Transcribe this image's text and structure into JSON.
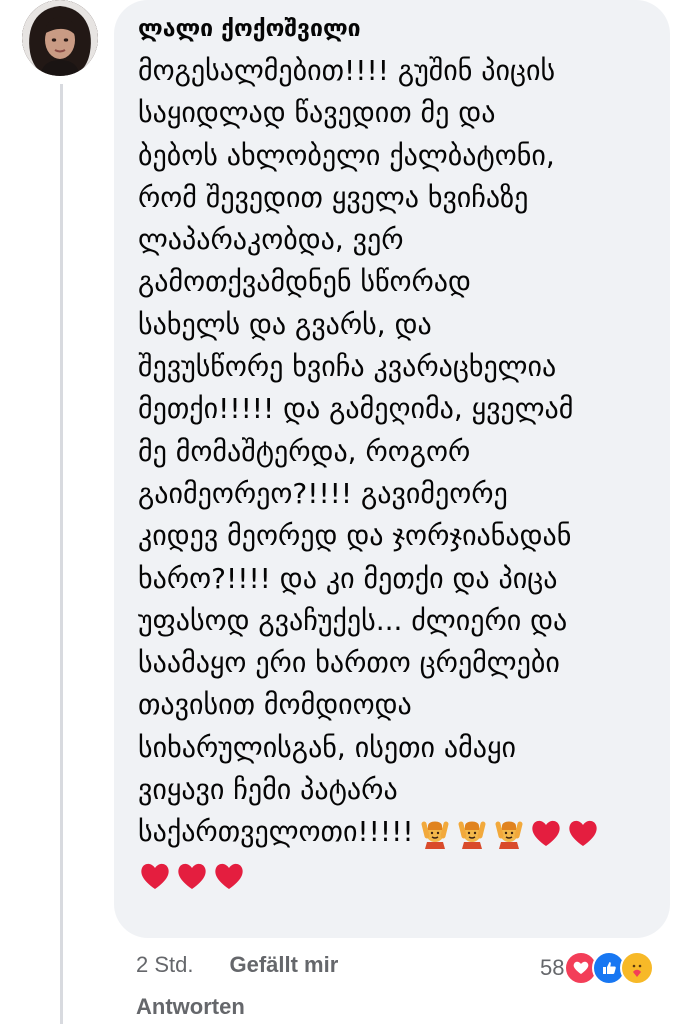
{
  "comment": {
    "author": "ლალი ქოქოშვილი",
    "lines": [
      "მოგესალმებით!!!! გუშინ პიცის",
      "საყიდლად წავედით მე და",
      "ბებოს ახლობელი ქალბატონი,",
      "რომ შევედით ყველა ხვიჩაზე",
      "ლაპარაკობდა, ვერ",
      "გამოთქვამდნენ სწორად",
      "სახელს და გვარს, და",
      "შევუსწორე ხვიჩა კვარაცხელია",
      "მეთქი!!!!! და გამეღიმა, ყველამ",
      "მე მომაშტერდა, როგორ",
      "გაიმეორეო?!!!! გავიმეორე",
      "კიდევ მეორედ და ჯორჯიანადან",
      "ხარო?!!!!  და კი მეთქი და პიცა",
      "უფასოდ გვაჩუქეს... ძლიერი და",
      "საამაყო ერი ხართო ცრემლები",
      "თავისით მომდიოდა",
      "სიხარულისგან, ისეთი ამაყი",
      "ვიყავი ჩემი პატარა",
      "საქართველოთი!!!!!"
    ],
    "emojis_inline": [
      "raising-hands-person",
      "raising-hands-person",
      "raising-hands-person",
      "red-heart",
      "red-heart"
    ],
    "emojis_last": [
      "red-heart",
      "red-heart",
      "red-heart"
    ]
  },
  "footer": {
    "time": "2 Std.",
    "like": "Gefällt mir",
    "reply": "Antworten"
  },
  "reactions": {
    "count": "58",
    "icons": [
      "love-reaction-icon",
      "like-reaction-icon",
      "care-reaction-icon"
    ]
  },
  "colors": {
    "bubble": "#f0f2f5",
    "text": "#050505",
    "meta": "#65676b",
    "heart": "#e41e3f",
    "like_blue": "#1877f2",
    "love_red": "#f33e58"
  }
}
